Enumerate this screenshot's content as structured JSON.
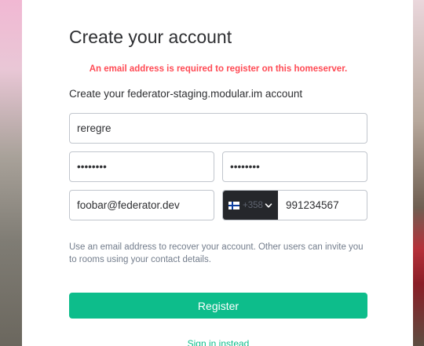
{
  "page": {
    "title": "Create your account",
    "error": "An email address is required to register on this homeserver.",
    "subtitle": "Create your federator-staging.modular.im account"
  },
  "form": {
    "username": {
      "value": "reregre"
    },
    "password": {
      "value": "••••••••"
    },
    "confirm_password": {
      "value": "••••••••"
    },
    "email": {
      "value": "foobar@federator.dev"
    },
    "phone": {
      "country_flag": "finland-flag-icon",
      "prefix": "+358",
      "value": "991234567"
    },
    "help_text": "Use an email address to recover your account. Other users can invite you to rooms using your contact details.",
    "register_label": "Register",
    "signin_label": "Sign in instead"
  },
  "colors": {
    "accent": "#0dbd8b",
    "error": "#ff4b55",
    "text": "#2e2f32",
    "muted": "#737d8c"
  }
}
